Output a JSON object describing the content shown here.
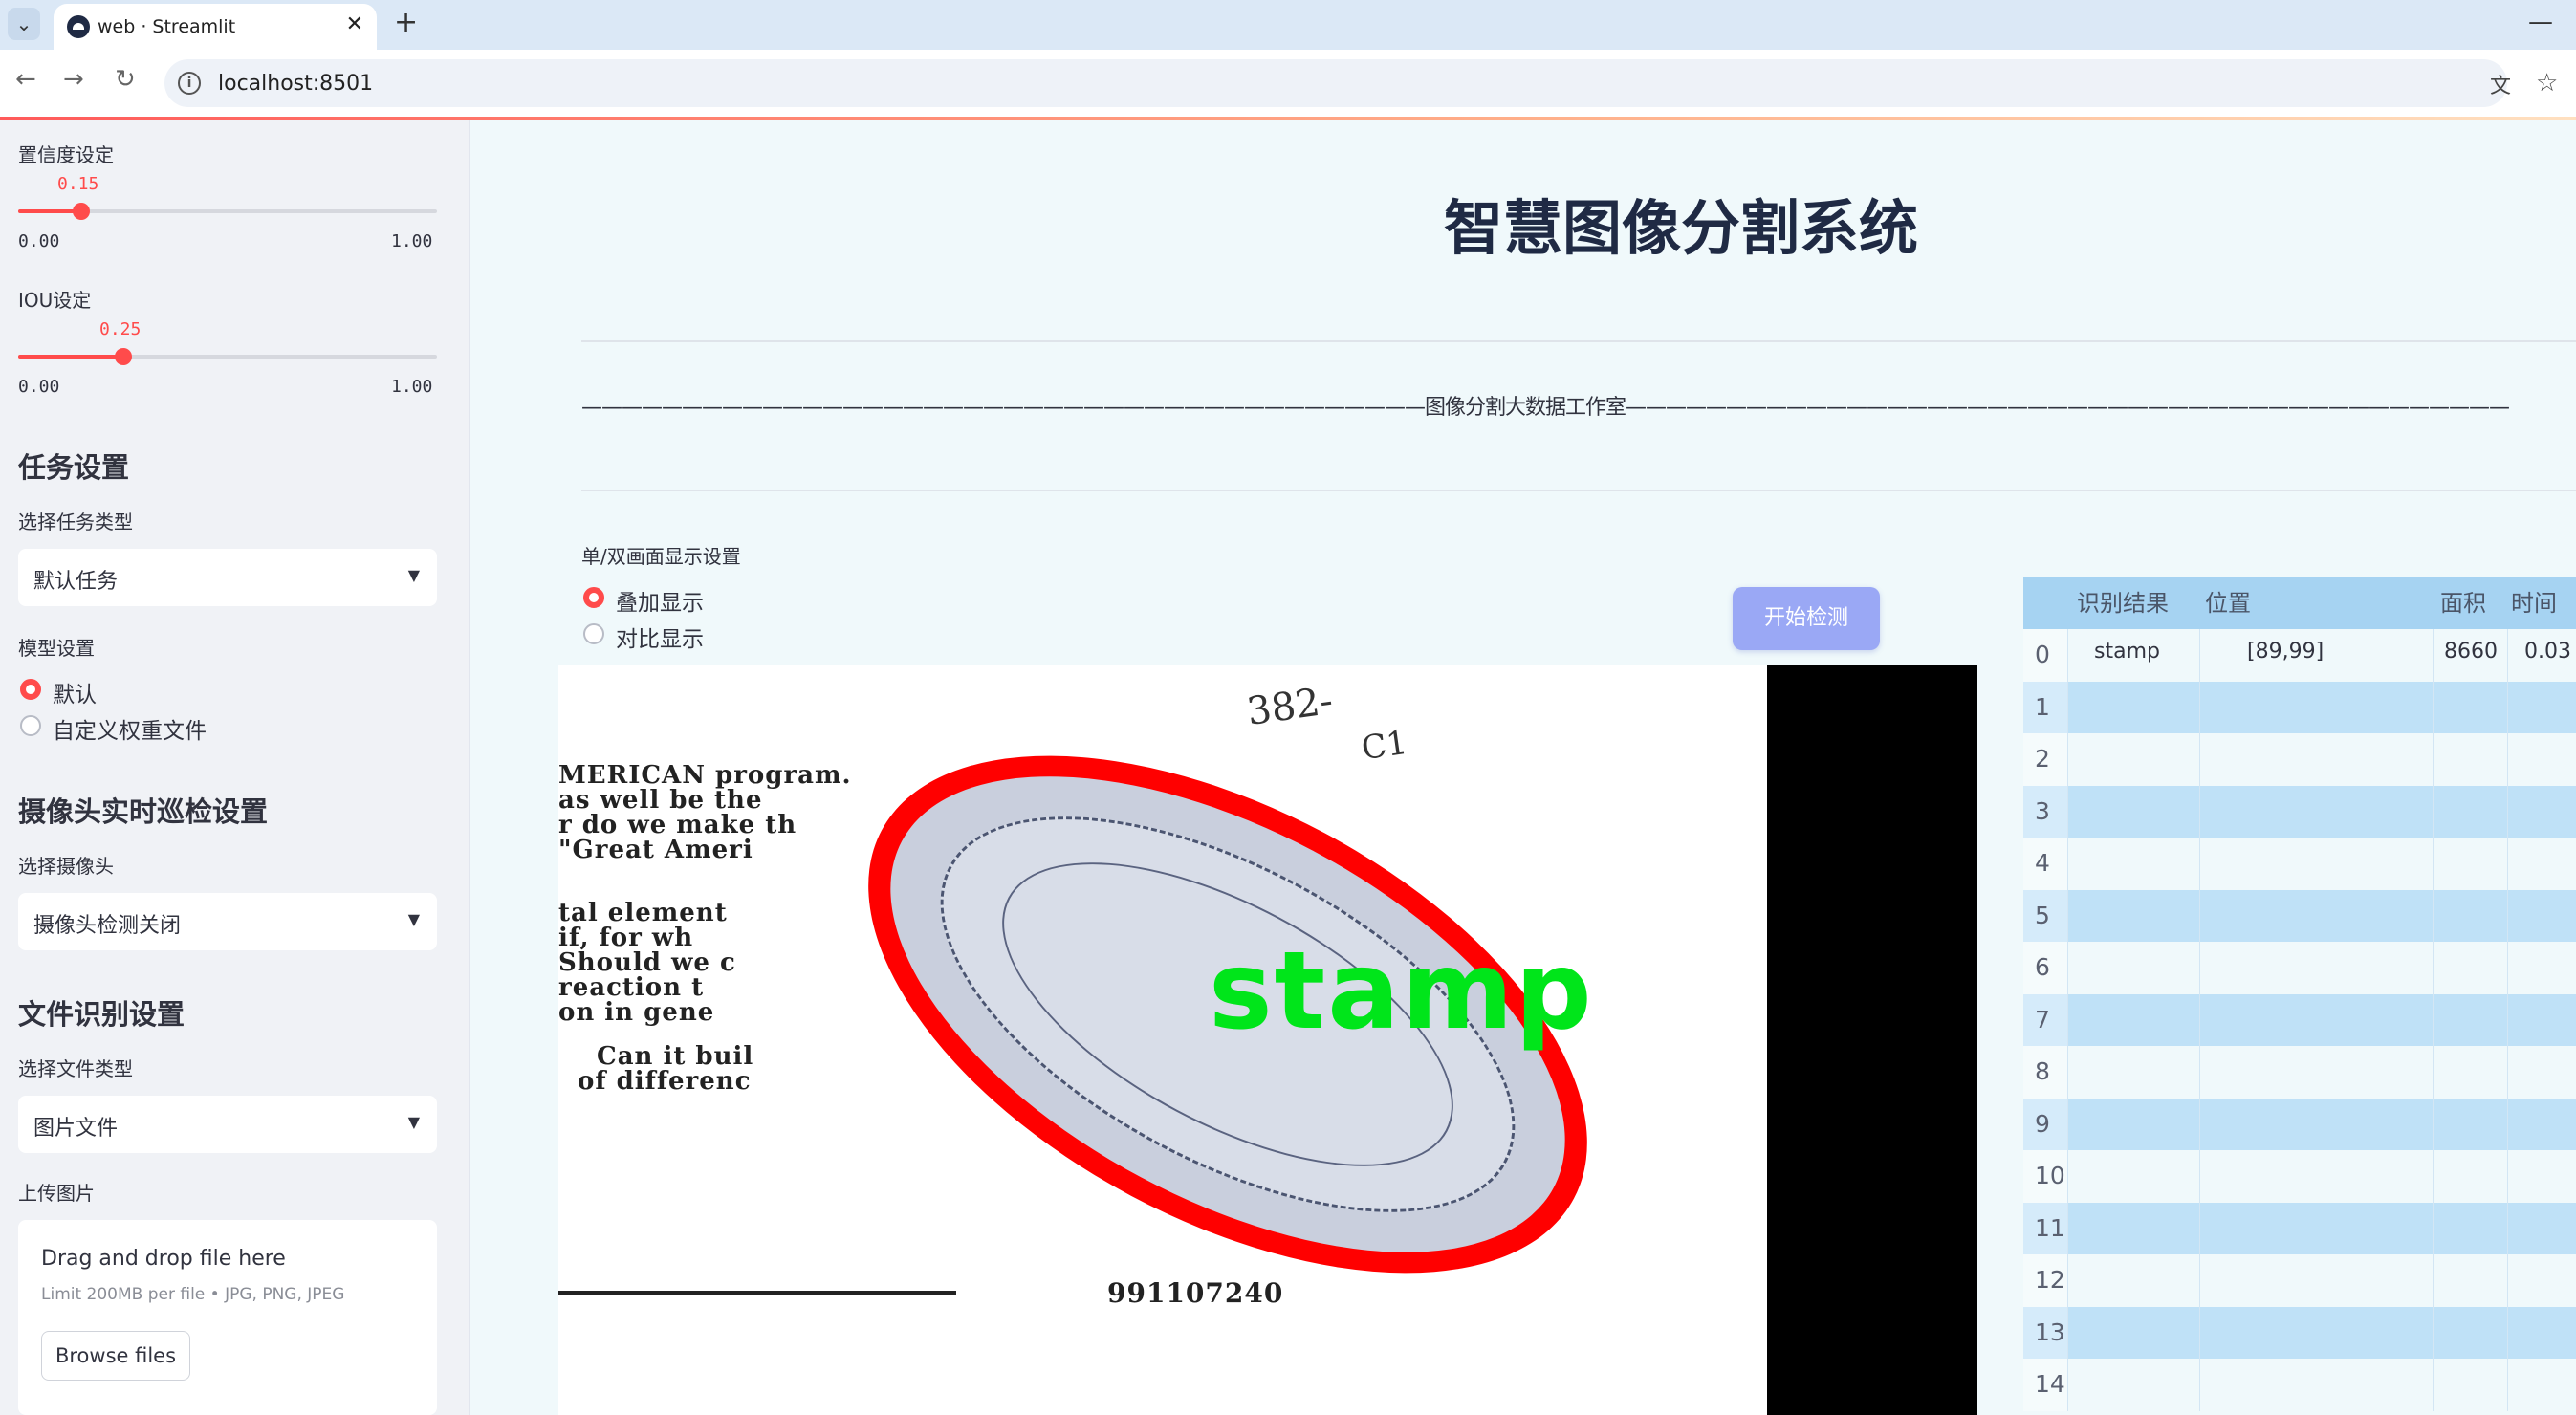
{
  "browser": {
    "tab_title": "web · Streamlit",
    "tab_close": "✕",
    "new_tab": "+",
    "minimize": "—",
    "url": "localhost:8501"
  },
  "sidebar": {
    "confidence": {
      "label": "置信度设定",
      "value": "0.15",
      "fraction": 0.15,
      "min": "0.00",
      "max": "1.00"
    },
    "iou": {
      "label": "IOU设定",
      "value": "0.25",
      "fraction": 0.25,
      "min": "0.00",
      "max": "1.00"
    },
    "task_header": "任务设置",
    "task_type_label": "选择任务类型",
    "task_type_value": "默认任务",
    "model_label": "模型设置",
    "model_options": [
      "默认",
      "自定义权重文件"
    ],
    "model_selected": 0,
    "camera_header": "摄像头实时巡检设置",
    "camera_label": "选择摄像头",
    "camera_value": "摄像头检测关闭",
    "file_header": "文件识别设置",
    "file_type_label": "选择文件类型",
    "file_type_value": "图片文件",
    "upload_label": "上传图片",
    "upload_title": "Drag and drop file here",
    "upload_limit": "Limit 200MB per file • JPG, PNG, JPEG",
    "browse_button": "Browse files"
  },
  "main": {
    "title": "智慧图像分割系统",
    "subtitle": "——————————————————————————————————————————图像分割大数据工作室————————————————————————————————————————————",
    "display_label": "单/双画面显示设置",
    "display_options": [
      "叠加显示",
      "对比显示"
    ],
    "display_selected": 0,
    "detect_button": "开始检测",
    "image": {
      "doc_lines": [
        "MERICAN program.",
        "as well be the",
        "r do we make th",
        "\"Great Ameri",
        "tal element",
        "if, for wh",
        "Should we c",
        "reaction t",
        "on in gene",
        "Can it buil",
        "of differenc"
      ],
      "handwriting": [
        "382-",
        "C1"
      ],
      "number": "991107240",
      "stamp_label": "stamp"
    },
    "table": {
      "columns": [
        "识别结果",
        "位置",
        "面积",
        "时间"
      ],
      "rows": [
        {
          "index": "0",
          "result": "stamp",
          "position": "[89,99]",
          "area": "8660",
          "time": "0.03"
        },
        {
          "index": "1"
        },
        {
          "index": "2"
        },
        {
          "index": "3"
        },
        {
          "index": "4"
        },
        {
          "index": "5"
        },
        {
          "index": "6"
        },
        {
          "index": "7"
        },
        {
          "index": "8"
        },
        {
          "index": "9"
        },
        {
          "index": "10"
        },
        {
          "index": "11"
        },
        {
          "index": "12"
        },
        {
          "index": "13"
        },
        {
          "index": "14"
        }
      ]
    }
  }
}
